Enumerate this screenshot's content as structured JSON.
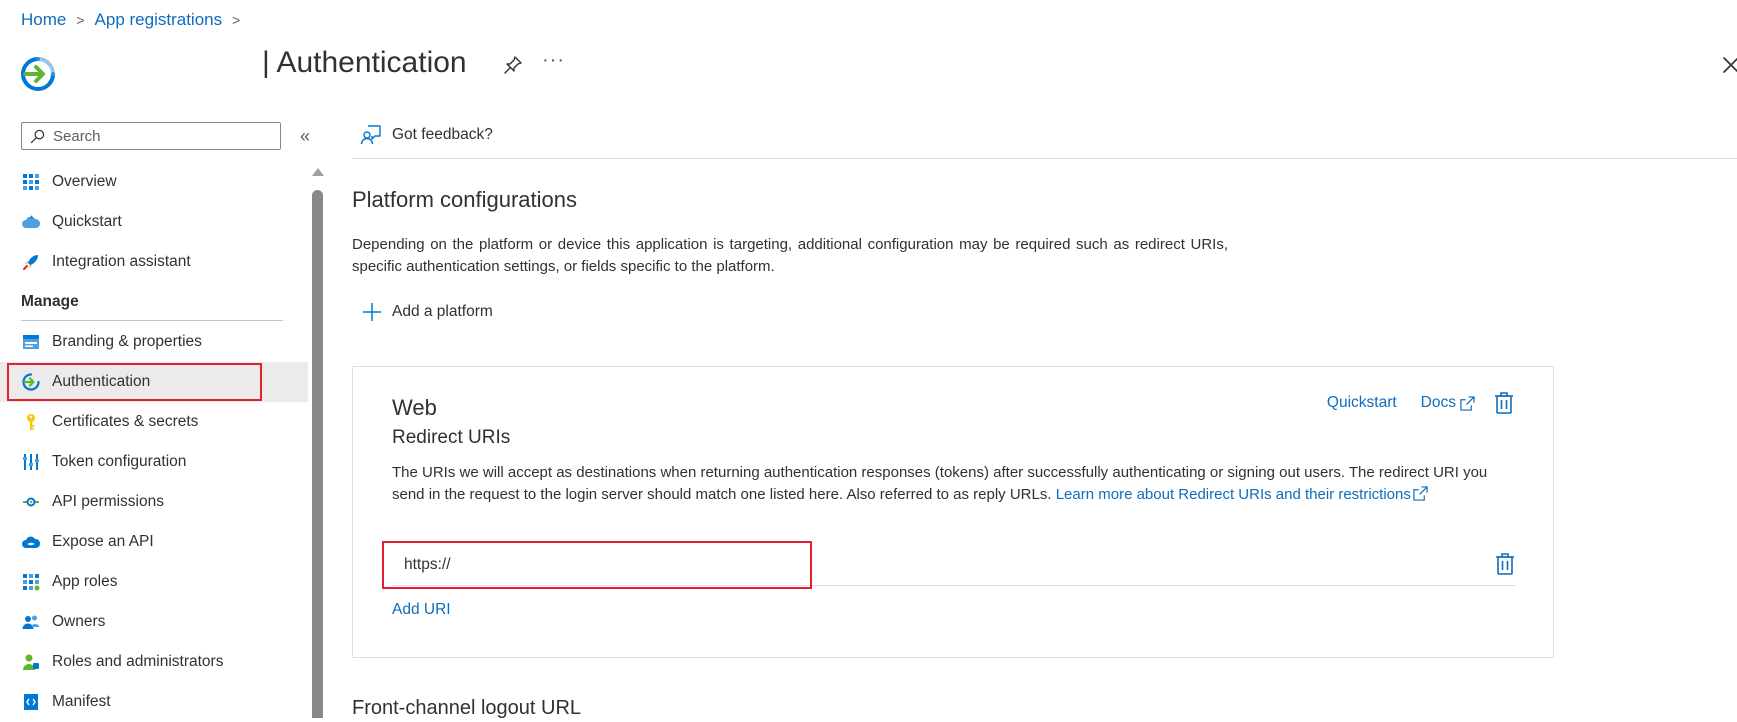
{
  "breadcrumb": {
    "home": "Home",
    "app_registrations": "App registrations",
    "separator": ">"
  },
  "header": {
    "title": "| Authentication",
    "more": "···"
  },
  "sidebar": {
    "search_placeholder": "Search",
    "collapse": "«",
    "items_top": [
      {
        "label": "Overview",
        "icon": "overview-grid-icon"
      },
      {
        "label": "Quickstart",
        "icon": "cloud-quickstart-icon"
      },
      {
        "label": "Integration assistant",
        "icon": "rocket-icon"
      }
    ],
    "section": "Manage",
    "items_manage": [
      {
        "label": "Branding & properties",
        "icon": "branding-icon"
      },
      {
        "label": "Authentication",
        "icon": "authentication-icon",
        "selected": true
      },
      {
        "label": "Certificates & secrets",
        "icon": "key-icon"
      },
      {
        "label": "Token configuration",
        "icon": "token-bars-icon"
      },
      {
        "label": "API permissions",
        "icon": "api-permissions-icon"
      },
      {
        "label": "Expose an API",
        "icon": "cloud-api-icon"
      },
      {
        "label": "App roles",
        "icon": "app-roles-grid-icon"
      },
      {
        "label": "Owners",
        "icon": "owners-icon"
      },
      {
        "label": "Roles and administrators",
        "icon": "roles-admin-icon"
      },
      {
        "label": "Manifest",
        "icon": "manifest-icon"
      }
    ]
  },
  "toolbar": {
    "feedback": "Got feedback?"
  },
  "main": {
    "title": "Platform configurations",
    "description": "Depending on the platform or device this application is targeting, additional configuration may be required such as redirect URIs, specific authentication settings, or fields specific to the platform.",
    "add_platform": "Add a platform",
    "web_card": {
      "title": "Web",
      "subtitle": "Redirect URIs",
      "quickstart": "Quickstart",
      "docs": "Docs",
      "description": "The URIs we will accept as destinations when returning authentication responses (tokens) after successfully authenticating or signing out users. The redirect URI you send in the request to the login server should match one listed here. Also referred to as reply URLs. ",
      "learn_more": "Learn more about Redirect URIs and their restrictions",
      "uri_value": "https://",
      "add_uri": "Add URI"
    },
    "next_section": "Front-channel logout URL"
  },
  "colors": {
    "accent": "#0f6cbd",
    "highlight": "#e3202e",
    "selected_bg": "#edebe9"
  }
}
